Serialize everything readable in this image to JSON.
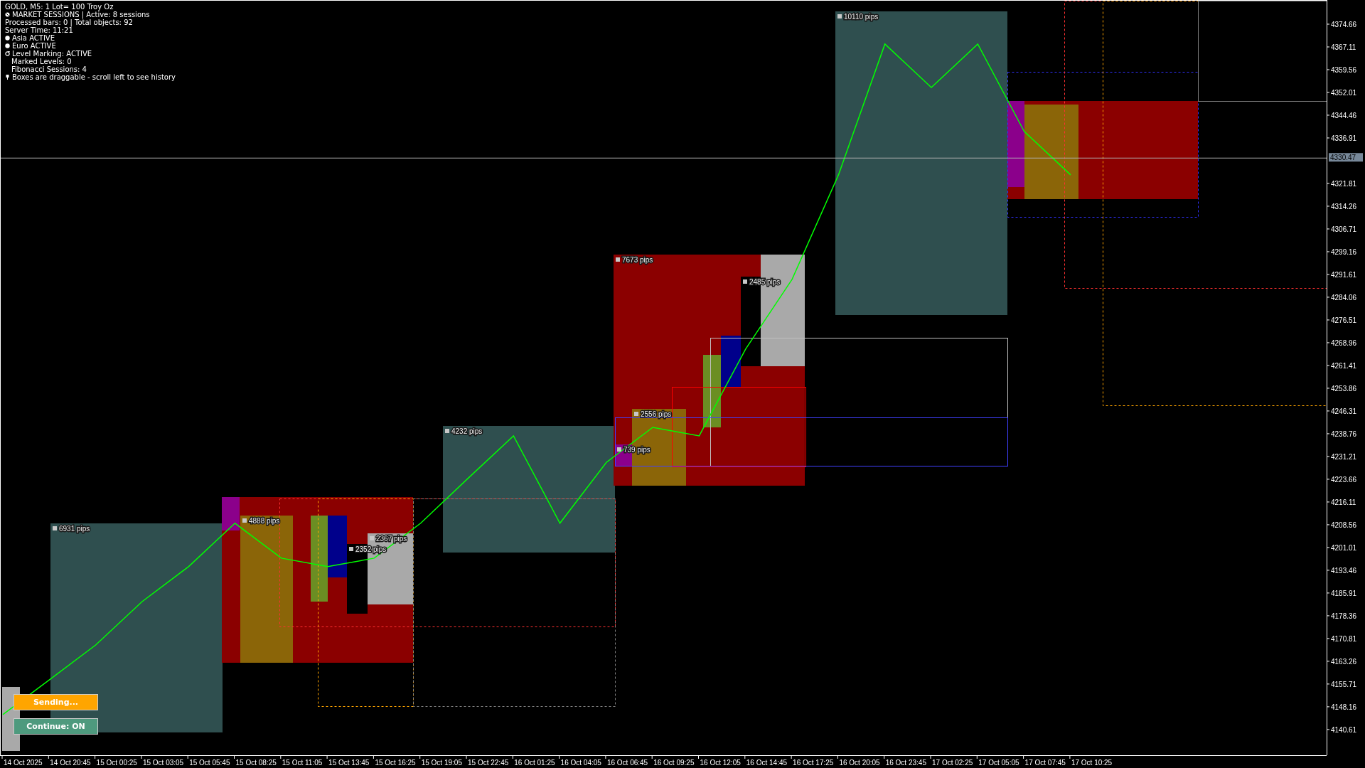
{
  "info_lines": [
    {
      "kind": "plain",
      "text": "GOLD, M5:  1 Lot= 100 Troy Oz"
    },
    {
      "kind": "sessions",
      "text": "MARKET SESSIONS | Active: 8 sessions"
    },
    {
      "kind": "plain",
      "text": "Processed bars: 0 | Total objects: 92"
    },
    {
      "kind": "plain",
      "text": "Server Time: 11:21"
    },
    {
      "kind": "bullet",
      "text": "Asia ACTIVE"
    },
    {
      "kind": "bullet",
      "text": "Euro ACTIVE"
    },
    {
      "kind": "level",
      "text": "Level Marking: ACTIVE"
    },
    {
      "kind": "indent",
      "text": "Marked Levels: 0"
    },
    {
      "kind": "indent",
      "text": "Fibonacci Sessions: 4"
    },
    {
      "kind": "pin",
      "text": "Boxes are draggable - scroll left to see history"
    }
  ],
  "session_boxes": [
    {
      "color": "#2f4f4f",
      "label": "6931 pips"
    },
    {
      "color": "#a9a9a9"
    },
    {
      "color": "#8b0000"
    },
    {
      "color": "#8b008b"
    },
    {
      "color": "#8b6508",
      "label": "4888 pips"
    },
    {
      "color": "#6b8e23"
    },
    {
      "color": "#00008b"
    },
    {
      "color": "#000000",
      "label": "2352 pips"
    },
    {
      "color": "#a9a9a9",
      "label": "2367 pips"
    },
    {
      "color": "#2f4f4f",
      "label": "4232 pips"
    },
    {
      "color": "#8b0000",
      "label": "7673 pips"
    },
    {
      "color": "#8b6508",
      "label": "2556 pips"
    },
    {
      "color": "#8b008b",
      "label": "739 pips"
    },
    {
      "color": "#6b8e23"
    },
    {
      "color": "#00008b"
    },
    {
      "color": "#000000",
      "label": "2485 pips"
    },
    {
      "color": "#a9a9a9"
    },
    {
      "color": "#2f4f4f",
      "label": "10110 pips"
    },
    {
      "color": "#8b0000"
    },
    {
      "color": "#8b008b"
    },
    {
      "color": "#8b6508"
    }
  ],
  "chart_data": {
    "type": "line",
    "categories": [
      "14 Oct 2025",
      "14 Oct 20:45",
      "15 Oct 00:25",
      "15 Oct 03:05",
      "15 Oct 05:45",
      "15 Oct 08:25",
      "15 Oct 11:05",
      "15 Oct 13:45",
      "15 Oct 16:25",
      "15 Oct 19:05",
      "15 Oct 22:45",
      "16 Oct 01:25",
      "16 Oct 04:05",
      "16 Oct 06:45",
      "16 Oct 09:25",
      "16 Oct 12:05",
      "16 Oct 14:45",
      "16 Oct 17:25",
      "16 Oct 20:05",
      "16 Oct 23:45",
      "17 Oct 02:25",
      "17 Oct 05:05",
      "17 Oct 07:45",
      "17 Oct 10:25"
    ],
    "series": [
      {
        "color": "#00ff00",
        "values": [
          4145.8,
          4157.3,
          4168.9,
          4183.3,
          4194.9,
          4209.3,
          4197.7,
          4194.9,
          4197.7,
          4209.3,
          4223.9,
          4238.3,
          4209.3,
          4229.5,
          4241.1,
          4238.3,
          4267.1,
          4290.2,
          4324.9,
          4368.3,
          4353.9,
          4368.3,
          4339.3,
          4324.9
        ]
      }
    ],
    "ylim": [
      4132.09,
      4382.68
    ],
    "yticks": [
      4374.66,
      4367.11,
      4359.56,
      4352.01,
      4344.46,
      4336.91,
      4321.81,
      4314.26,
      4306.71,
      4299.16,
      4291.61,
      4284.06,
      4276.51,
      4268.96,
      4261.41,
      4253.86,
      4246.31,
      4238.76,
      4231.21,
      4223.66,
      4216.11,
      4208.56,
      4201.01,
      4193.46,
      4185.91,
      4178.36,
      4170.81,
      4163.26,
      4155.71,
      4148.16,
      4140.61
    ],
    "ref_lines": [
      {
        "axis": "y",
        "value": 4330.47,
        "label": "4330.47"
      }
    ]
  },
  "buttons": [
    {
      "kind": "status",
      "label": "Sending..."
    },
    {
      "kind": "toggle",
      "label": "Continue: ON",
      "on": true
    }
  ]
}
